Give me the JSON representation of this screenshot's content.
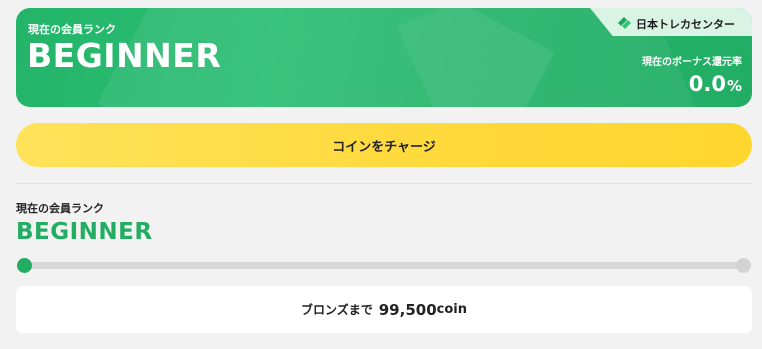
{
  "member_card": {
    "label": "現在の会員ランク",
    "rank": "BEGINNER",
    "brand": {
      "name": "日本トレカセンター",
      "logo_icon": "diamond-logo",
      "logo_colors": [
        "#1fa25a",
        "#35c374"
      ]
    },
    "bonus_label": "現在のボーナス還元率",
    "bonus_value": "0.0",
    "bonus_unit": "%",
    "colors": {
      "background": "#2cbf73",
      "text": "#ffffff",
      "brand_tab": "#d9f3e4"
    }
  },
  "charge_button": {
    "label": "コインをチャージ",
    "color": "#ffd93a"
  },
  "rank_section": {
    "label": "現在の会員ランク",
    "rank": "BEGINNER",
    "rank_color": "#23ad63",
    "progress": {
      "value": 0,
      "fill_color": "#23ad63",
      "track_color": "#d8d8d8"
    },
    "next_rank": {
      "label": "ブロンズまで",
      "amount": "99,500",
      "unit": "coin"
    }
  }
}
